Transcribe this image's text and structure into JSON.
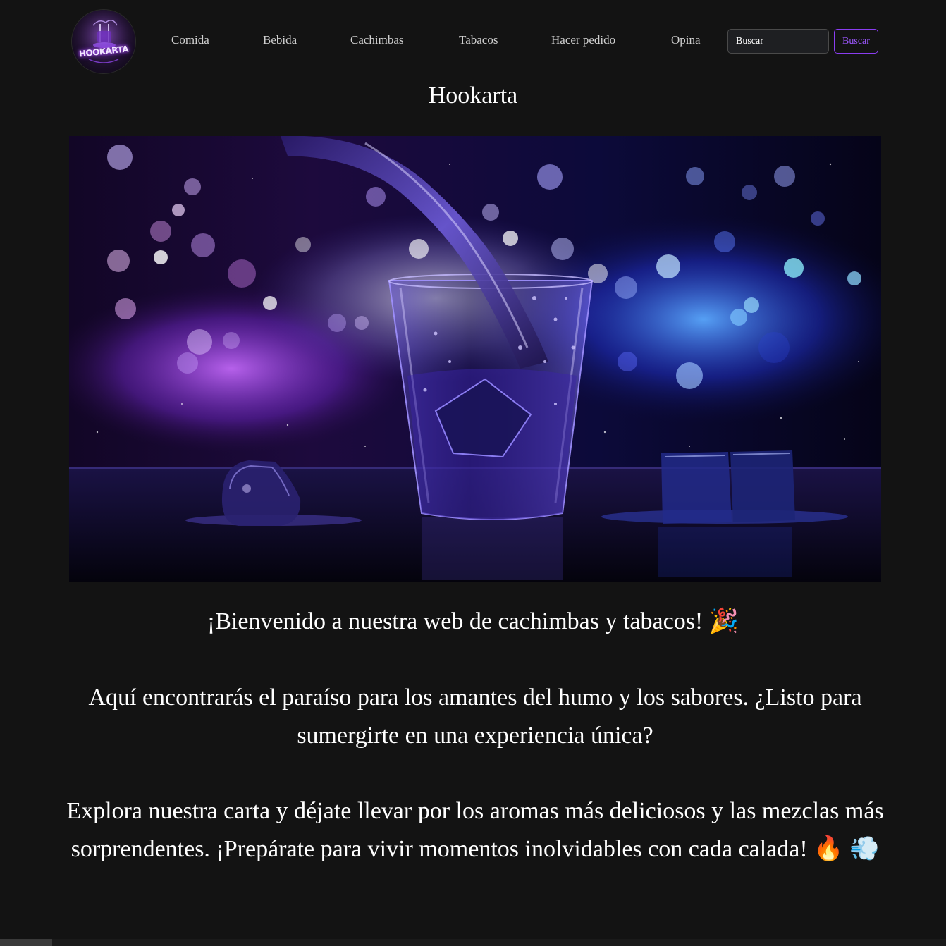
{
  "brand": {
    "logo_text": "HOOKARTA",
    "logo_icon": "hookah-logo-icon"
  },
  "nav": {
    "items": [
      {
        "label": "Comida"
      },
      {
        "label": "Bebida"
      },
      {
        "label": "Cachimbas"
      },
      {
        "label": "Tabacos"
      },
      {
        "label": "Hacer pedido"
      },
      {
        "label": "Opina"
      }
    ],
    "search_placeholder": "Buscar",
    "search_button": "Buscar"
  },
  "header": {
    "title": "Hookarta"
  },
  "hero": {
    "icon": "hero-drink-glass-image"
  },
  "content": {
    "welcome": "¡Bienvenido a nuestra web de cachimbas y tabacos! 🎉",
    "paragraph_1": "Aquí encontrarás el paraíso para los amantes del humo y los sabores. ¿Listo para sumergirte en una experiencia única?",
    "paragraph_2": "Explora nuestra carta y déjate llevar por los aromas más deliciosos y las mezclas más sorprendentes. ¡Prepárate para vivir momentos inolvidables con cada calada! 🔥 💨"
  },
  "colors": {
    "background": "#131313",
    "accent": "#8a3df0",
    "text": "#ffffff",
    "nav_text": "#cfcfcf"
  }
}
